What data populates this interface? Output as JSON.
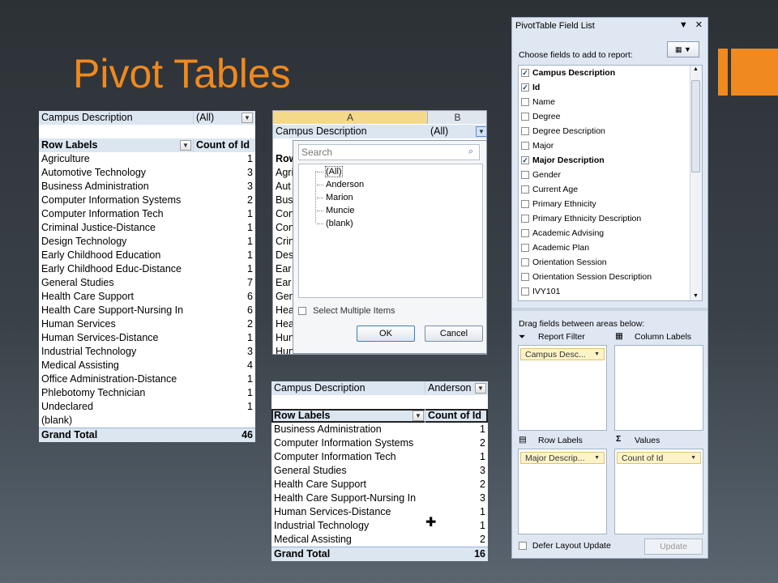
{
  "slide": {
    "title": "Pivot Tables"
  },
  "pivot1": {
    "filter_field": "Campus Description",
    "filter_value": "(All)",
    "row_header": "Row Labels",
    "value_header": "Count of Id",
    "rows": [
      {
        "label": "Agriculture",
        "value": "1"
      },
      {
        "label": "Automotive Technology",
        "value": "3"
      },
      {
        "label": "Business Administration",
        "value": "3"
      },
      {
        "label": "Computer Information Systems",
        "value": "2"
      },
      {
        "label": "Computer Information Tech",
        "value": "1"
      },
      {
        "label": "Criminal Justice-Distance",
        "value": "1"
      },
      {
        "label": "Design Technology",
        "value": "1"
      },
      {
        "label": "Early Childhood Education",
        "value": "1"
      },
      {
        "label": "Early Childhood Educ-Distance",
        "value": "1"
      },
      {
        "label": "General Studies",
        "value": "7"
      },
      {
        "label": "Health Care Support",
        "value": "6"
      },
      {
        "label": "Health Care Support-Nursing In",
        "value": "6"
      },
      {
        "label": "Human Services",
        "value": "2"
      },
      {
        "label": "Human Services-Distance",
        "value": "1"
      },
      {
        "label": "Industrial Technology",
        "value": "3"
      },
      {
        "label": "Medical Assisting",
        "value": "4"
      },
      {
        "label": "Office Administration-Distance",
        "value": "1"
      },
      {
        "label": "Phlebotomy Technician",
        "value": "1"
      },
      {
        "label": "Undeclared",
        "value": "1"
      },
      {
        "label": "(blank)",
        "value": ""
      }
    ],
    "total_label": "Grand Total",
    "total_value": "46"
  },
  "filter_window": {
    "col_a": "A",
    "col_b": "B",
    "filter_field": "Campus Description",
    "filter_value": "(All)",
    "stubs": [
      "Row",
      "Agri",
      "Aut",
      "Bus",
      "Con",
      "Con",
      "Crin",
      "Des",
      "Ear",
      "Ear",
      "Gen",
      "Hea",
      "Hea",
      "Hun",
      "Hun"
    ],
    "search_placeholder": "Search",
    "options": [
      "(All)",
      "Anderson",
      "Marion",
      "Muncie",
      "(blank)"
    ],
    "multi_label": "Select Multiple Items",
    "ok": "OK",
    "cancel": "Cancel"
  },
  "pivot2": {
    "filter_field": "Campus Description",
    "filter_value": "Anderson",
    "row_header": "Row Labels",
    "value_header": "Count of Id",
    "rows": [
      {
        "label": "Business Administration",
        "value": "1"
      },
      {
        "label": "Computer Information Systems",
        "value": "2"
      },
      {
        "label": "Computer Information Tech",
        "value": "1"
      },
      {
        "label": "General Studies",
        "value": "3"
      },
      {
        "label": "Health Care Support",
        "value": "2"
      },
      {
        "label": "Health Care Support-Nursing In",
        "value": "3"
      },
      {
        "label": "Human Services-Distance",
        "value": "1"
      },
      {
        "label": "Industrial Technology",
        "value": "1"
      },
      {
        "label": "Medical Assisting",
        "value": "2"
      }
    ],
    "total_label": "Grand Total",
    "total_value": "16"
  },
  "field_list": {
    "title": "PivotTable Field List",
    "choose_label": "Choose fields to add to report:",
    "fields": [
      {
        "name": "Campus Description",
        "checked": true
      },
      {
        "name": "Id",
        "checked": true
      },
      {
        "name": "Name",
        "checked": false
      },
      {
        "name": "Degree",
        "checked": false
      },
      {
        "name": "Degree Description",
        "checked": false
      },
      {
        "name": "Major",
        "checked": false
      },
      {
        "name": "Major Description",
        "checked": true
      },
      {
        "name": "Gender",
        "checked": false
      },
      {
        "name": "Current Age",
        "checked": false
      },
      {
        "name": "Primary Ethnicity",
        "checked": false
      },
      {
        "name": "Primary Ethnicity Description",
        "checked": false
      },
      {
        "name": "Academic Advising",
        "checked": false
      },
      {
        "name": "Academic Plan",
        "checked": false
      },
      {
        "name": "Orientation Session",
        "checked": false
      },
      {
        "name": "Orientation Session Description",
        "checked": false
      },
      {
        "name": "IVY101",
        "checked": false
      }
    ],
    "drag_label": "Drag fields between areas below:",
    "report_filter_label": "Report Filter",
    "column_labels_label": "Column Labels",
    "row_labels_label": "Row Labels",
    "values_label": "Values",
    "report_filter_chip": "Campus Desc...",
    "row_labels_chip": "Major Descrip...",
    "values_chip": "Count of Id",
    "defer_label": "Defer Layout Update",
    "update_label": "Update"
  }
}
